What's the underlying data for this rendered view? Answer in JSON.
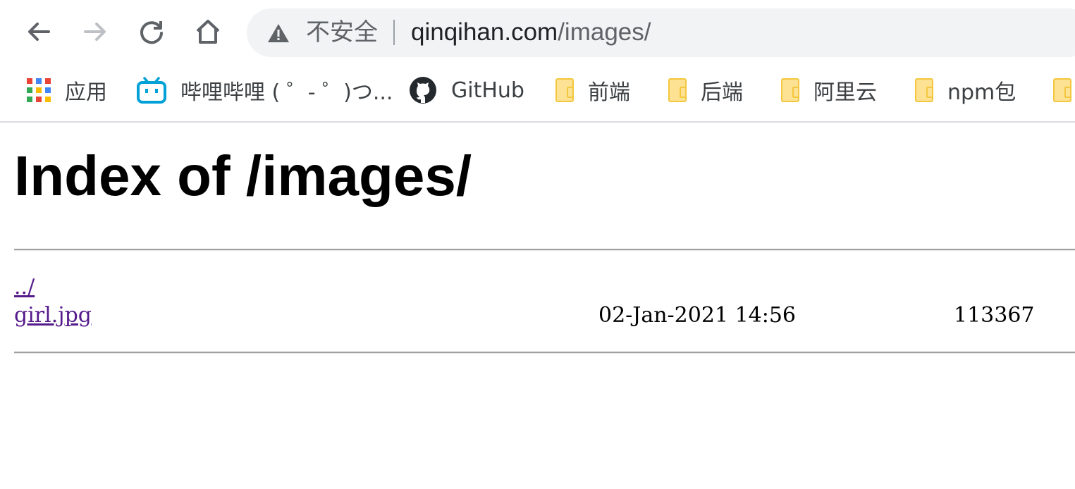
{
  "toolbar": {
    "back_icon": "arrow-left-icon",
    "forward_icon": "arrow-right-icon",
    "reload_icon": "reload-icon",
    "home_icon": "home-icon",
    "security_label": "不安全",
    "url_host": "qinqihan.com",
    "url_path": "/images/"
  },
  "bookmarks": [
    {
      "label": "应用",
      "icon": "apps-grid-icon"
    },
    {
      "label": "哔哩哔哩 ( ゜- ゜)つ...",
      "icon": "bilibili-icon"
    },
    {
      "label": "GitHub",
      "icon": "github-icon"
    },
    {
      "label": "前端",
      "icon": "folder-icon"
    },
    {
      "label": "后端",
      "icon": "folder-icon"
    },
    {
      "label": "阿里云",
      "icon": "folder-icon"
    },
    {
      "label": "npm包",
      "icon": "folder-icon"
    }
  ],
  "page": {
    "title": "Index of /images/",
    "entries": [
      {
        "name": "../",
        "date": "",
        "size": ""
      },
      {
        "name": "girl.jpg",
        "date": "02-Jan-2021 14:56",
        "size": "113367"
      }
    ]
  },
  "colors": {
    "link_visited": "#551a8b",
    "omnibox_bg": "#f1f3f4",
    "folder_fill": "#fde293"
  }
}
